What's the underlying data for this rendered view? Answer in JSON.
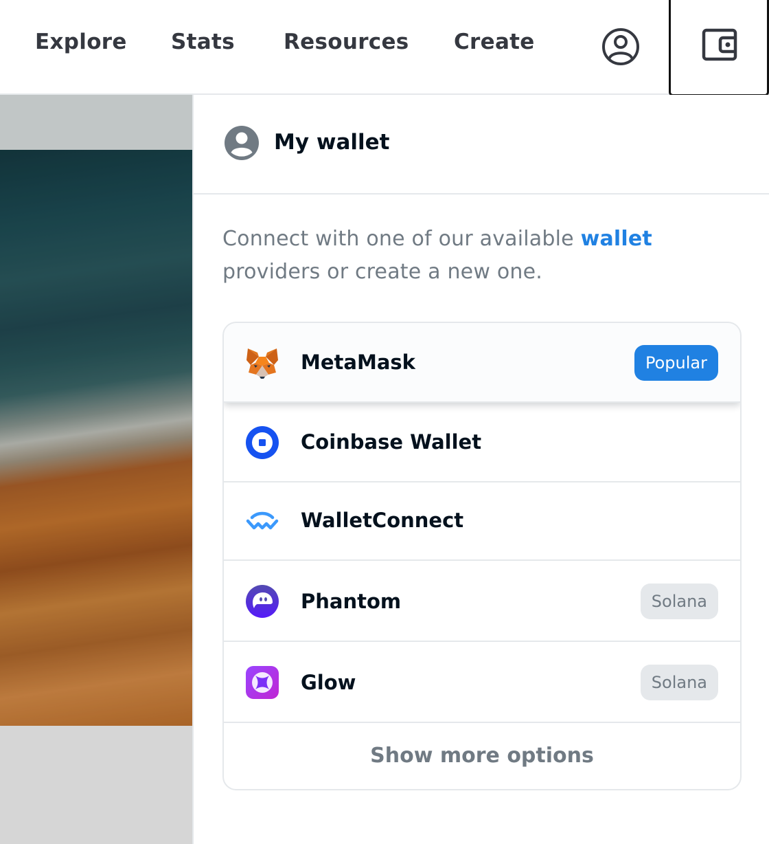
{
  "nav": {
    "links": [
      "Explore",
      "Stats",
      "Resources",
      "Create"
    ],
    "profile_icon": "account-circle-icon",
    "wallet_icon": "wallet-icon"
  },
  "wallet_panel": {
    "title": "My wallet",
    "description_before": "Connect with one of our available ",
    "description_link": "wallet",
    "description_after": " providers or create a new one.",
    "wallets": [
      {
        "name": "MetaMask",
        "icon": "metamask-fox-icon",
        "tag": "Popular"
      },
      {
        "name": "Coinbase Wallet",
        "icon": "coinbase-icon",
        "tag": ""
      },
      {
        "name": "WalletConnect",
        "icon": "walletconnect-icon",
        "tag": ""
      },
      {
        "name": "Phantom",
        "icon": "phantom-ghost-icon",
        "tag": "Solana"
      },
      {
        "name": "Glow",
        "icon": "glow-icon",
        "tag": "Solana"
      }
    ],
    "show_more": "Show more options"
  },
  "colors": {
    "accent": "#2081e2",
    "text_primary": "#04111d",
    "text_secondary": "#707a83",
    "tag_background": "#e5e8eb"
  }
}
